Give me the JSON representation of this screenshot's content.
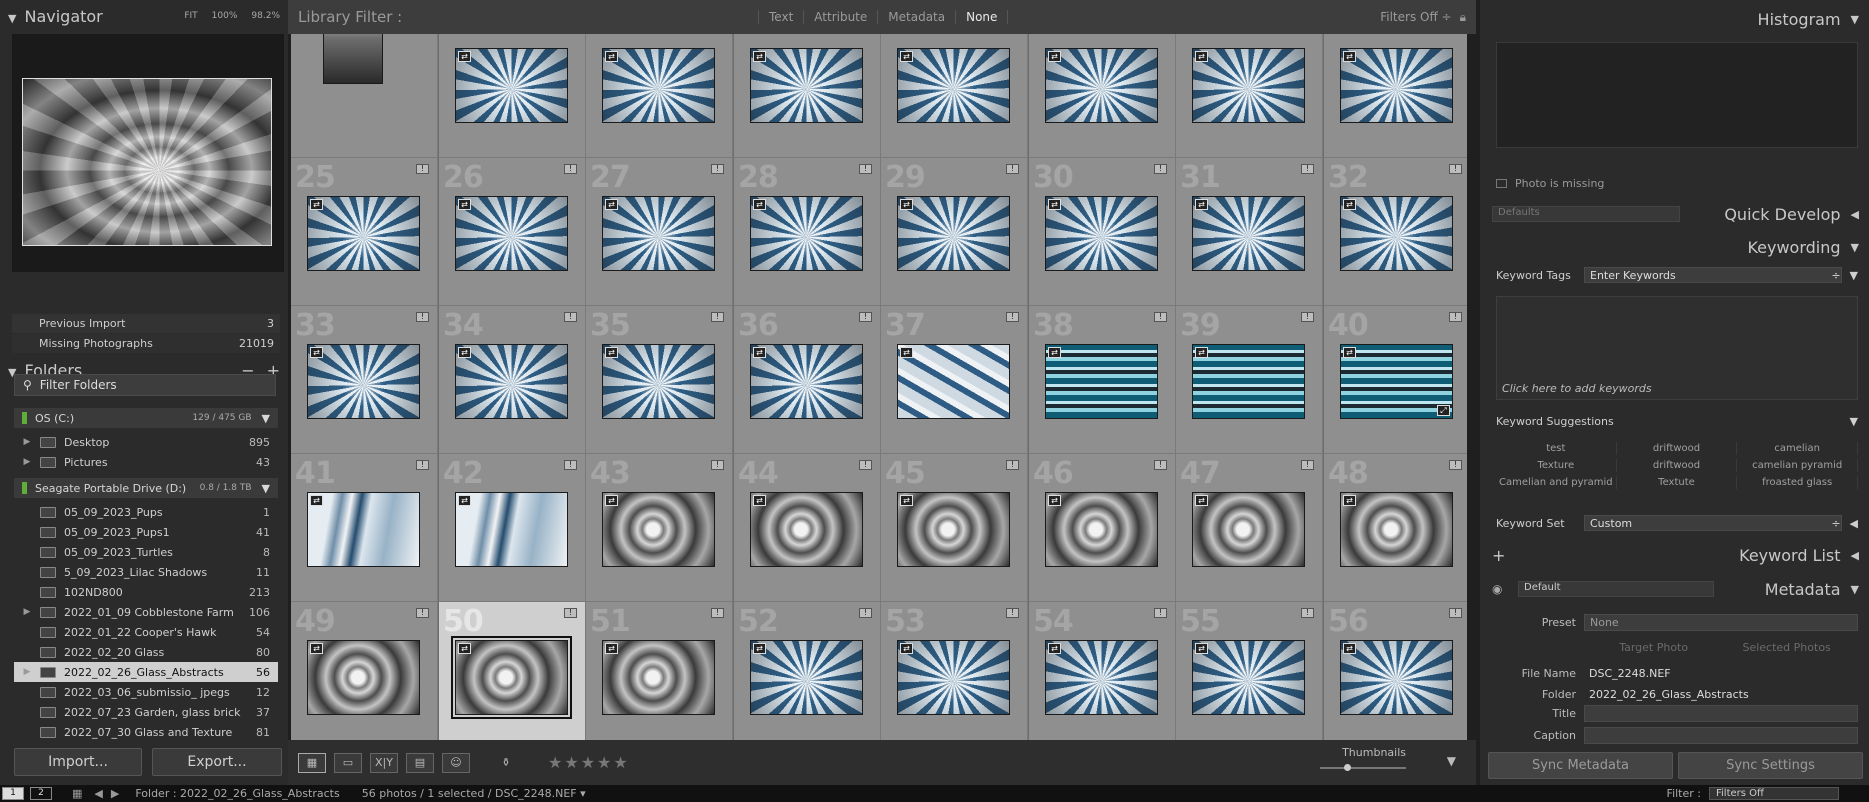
{
  "navigator": {
    "title": "Navigator",
    "zoom_options": [
      "FIT",
      "100%",
      "98.2%"
    ]
  },
  "catalog": [
    {
      "label": "Previous Import",
      "count": "3"
    },
    {
      "label": "Missing Photographs",
      "count": "21019"
    }
  ],
  "folders": {
    "title": "Folders",
    "minus": "−",
    "plus": "+",
    "filter_placeholder": "Filter Folders",
    "volumes": [
      {
        "name": "OS (C:)",
        "size": "129 / 475 GB"
      },
      {
        "name": "Seagate Portable Drive (D:)",
        "size": "0.8 / 1.8 TB"
      }
    ],
    "c_items": [
      {
        "name": "Desktop",
        "count": "895"
      },
      {
        "name": "Pictures",
        "count": "43"
      }
    ],
    "d_items": [
      {
        "name": "05_09_2023_Pups",
        "count": "1"
      },
      {
        "name": "05_09_2023_Pups1",
        "count": "41"
      },
      {
        "name": "05_09_2023_Turtles",
        "count": "8"
      },
      {
        "name": "5_09_2023_Lilac Shadows",
        "count": "11"
      },
      {
        "name": "102ND800",
        "count": "213"
      },
      {
        "name": "2022_01_09 Cobblestone Farm",
        "count": "106"
      },
      {
        "name": "2022_01_22 Cooper's Hawk",
        "count": "54"
      },
      {
        "name": "2022_02_20 Glass",
        "count": "80"
      },
      {
        "name": "2022_02_26_Glass_Abstracts",
        "count": "56"
      },
      {
        "name": "2022_03_06_submissio_ jpegs",
        "count": "12"
      },
      {
        "name": "2022_07_23 Garden, glass brick",
        "count": "37"
      },
      {
        "name": "2022_07_30 Glass and Texture",
        "count": "81"
      }
    ],
    "selected_index": 8
  },
  "buttons": {
    "import": "Import...",
    "export": "Export..."
  },
  "filter_bar": {
    "title": "Library Filter :",
    "options": [
      "Text",
      "Attribute",
      "Metadata",
      "None"
    ],
    "active": "None",
    "filters_off": "Filters Off ÷"
  },
  "grid": {
    "rows": [
      {
        "nums": [
          "",
          "",
          "",
          "",
          "",
          "",
          "",
          ""
        ],
        "types": [
          "tall",
          "blue",
          "blue",
          "blue",
          "blue",
          "blue",
          "blue",
          "blue"
        ]
      },
      {
        "nums": [
          "25",
          "26",
          "27",
          "28",
          "29",
          "30",
          "31",
          "32"
        ],
        "types": [
          "blue",
          "blue",
          "blue",
          "blue",
          "blue",
          "blue",
          "blue",
          "blue"
        ]
      },
      {
        "nums": [
          "33",
          "34",
          "35",
          "36",
          "37",
          "38",
          "39",
          "40"
        ],
        "types": [
          "blue",
          "blue",
          "blue",
          "blue",
          "stripe",
          "glass",
          "glass",
          "glass"
        ]
      },
      {
        "nums": [
          "41",
          "42",
          "43",
          "44",
          "45",
          "46",
          "47",
          "48"
        ],
        "types": [
          "streak",
          "streak",
          "gray",
          "gray",
          "gray",
          "gray",
          "gray",
          "gray"
        ]
      },
      {
        "nums": [
          "49",
          "50",
          "51",
          "52",
          "53",
          "54",
          "55",
          "56"
        ],
        "types": [
          "gray",
          "gray",
          "gray",
          "blue",
          "blue",
          "blue",
          "blue",
          "blue"
        ]
      }
    ],
    "selected": "50"
  },
  "toolbar": {
    "view_icons": [
      "grid-view-icon",
      "loupe-view-icon",
      "compare-view-icon",
      "survey-view-icon",
      "people-view-icon",
      "spray-can-icon"
    ],
    "compare_label": "X|Y",
    "stars": "★★★★★",
    "thumbnails_label": "Thumbnails"
  },
  "right": {
    "histogram_title": "Histogram",
    "photo_missing": "Photo is missing",
    "quick_develop": "Quick Develop",
    "defaults": "Defaults",
    "keywording": "Keywording",
    "keyword_tags_label": "Keyword Tags",
    "keyword_tags_value": "Enter Keywords",
    "add_keywords_hint": "Click here to add keywords",
    "suggestions_title": "Keyword Suggestions",
    "suggestions": [
      "test",
      "driftwood",
      "camelian",
      "Texture",
      "driftwood",
      "camelian  pyramid",
      "Camelian and pyramid",
      "Textute",
      "froasted glass"
    ],
    "keyword_set_label": "Keyword Set",
    "keyword_set_value": "Custom",
    "keyword_list": "Keyword List",
    "metadata_title": "Metadata",
    "metadata_preset_select": "Default",
    "preset_label": "Preset",
    "preset_value": "None",
    "target_photo": "Target Photo",
    "selected_photos": "Selected Photos",
    "file_name_label": "File Name",
    "file_name_value": "DSC_2248.NEF",
    "folder_label": "Folder",
    "folder_value": "2022_02_26_Glass_Abstracts",
    "title_label": "Title",
    "caption_label": "Caption",
    "sync_metadata": "Sync Metadata",
    "sync_settings": "Sync Settings"
  },
  "status": {
    "monitors": [
      "1",
      "2"
    ],
    "path": "Folder : 2022_02_26_Glass_Abstracts",
    "summary": "56 photos / 1 selected / DSC_2248.NEF ▾",
    "filter_label": "Filter :",
    "filter_value": "Filters Off"
  }
}
